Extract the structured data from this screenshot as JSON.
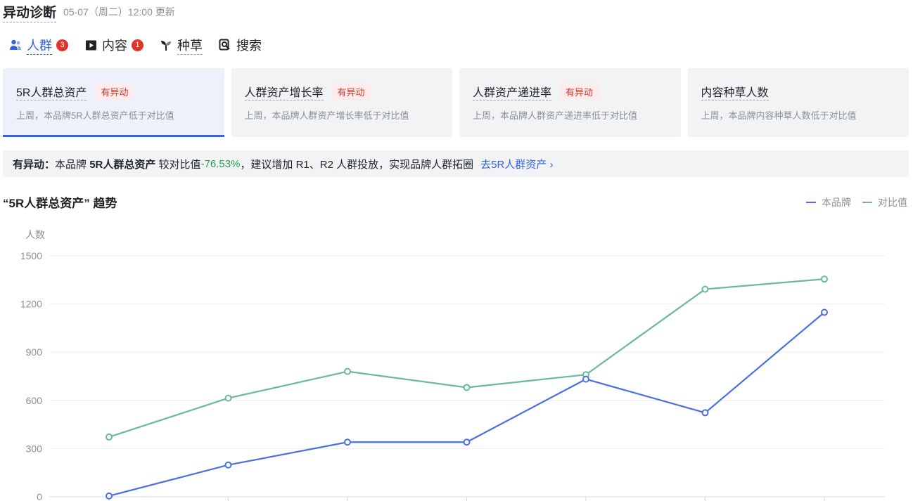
{
  "header": {
    "title": "异动诊断",
    "updated": "05-07（周二）12:00 更新"
  },
  "tabs": [
    {
      "label": "人群",
      "badge": "3",
      "icon": "user-group-icon"
    },
    {
      "label": "内容",
      "badge": "1",
      "icon": "play-square-icon"
    },
    {
      "label": "种草",
      "badge": "",
      "icon": "sprout-icon"
    },
    {
      "label": "搜索",
      "badge": "",
      "icon": "search-icon"
    }
  ],
  "cards": [
    {
      "title": "5R人群总资产",
      "tag": "有异动",
      "desc": "上周，本品牌5R人群总资产低于对比值"
    },
    {
      "title": "人群资产增长率",
      "tag": "有异动",
      "desc": "上周，本品牌人群资产增长率低于对比值"
    },
    {
      "title": "人群资产递进率",
      "tag": "有异动",
      "desc": "上周，本品牌人群资产递进率低于对比值"
    },
    {
      "title": "内容种草人数",
      "tag": "",
      "desc": "上周，本品牌内容种草人数低于对比值"
    }
  ],
  "alert": {
    "prefix": "有异动：",
    "text1": "本品牌 ",
    "metric": "5R人群总资产",
    "text2": " 较对比值",
    "value": "-76.53%",
    "text3": "，建议增加 R1、R2 人群投放，实现品牌人群拓圈",
    "link": "去5R人群资产 ›"
  },
  "chart_title": "“5R人群总资产” 趋势",
  "colors": {
    "accent": "#3662e3",
    "brand_line": "#4a6fe3",
    "compare_line": "#6ab99a",
    "alert_red": "#d9362b",
    "negative_green": "#2e9e58"
  },
  "chart_data": {
    "type": "line",
    "ylabel": "人数",
    "ylim": [
      0,
      1500
    ],
    "yticks": [
      0,
      300,
      600,
      900,
      1200,
      1500
    ],
    "x": [
      1,
      2,
      3,
      4,
      5,
      6,
      7
    ],
    "series": [
      {
        "name": "本品牌",
        "values": [
          5,
          198,
          340,
          340,
          732,
          523,
          1148
        ]
      },
      {
        "name": "对比值",
        "values": [
          372,
          614,
          780,
          680,
          760,
          1292,
          1355
        ]
      }
    ],
    "legend_position": "top-right",
    "grid": true
  }
}
